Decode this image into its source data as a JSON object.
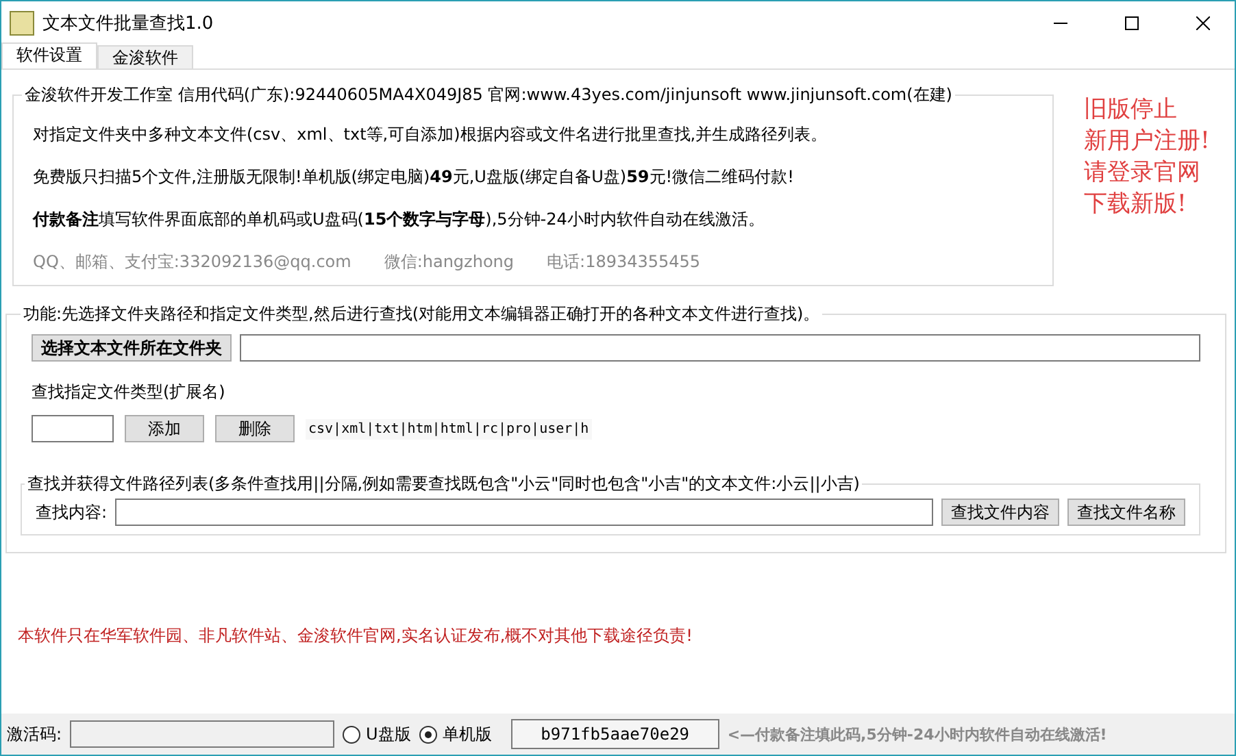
{
  "window": {
    "title": "文本文件批量查找1.0"
  },
  "tabs": [
    {
      "label": "软件设置",
      "selected": true
    },
    {
      "label": "金浚软件",
      "selected": false
    }
  ],
  "info": {
    "legend": "金浚软件开发工作室 信用代码(广东):92440605MA4X049J85 官网:www.43yes.com/jinjunsoft  www.jinjunsoft.com(在建)",
    "lines": [
      "对指定文件夹中多种文本文件(csv、xml、txt等,可自添加)根据内容或文件名进行批里查找,并生成路径列表。",
      "免费版只扫描5个文件,注册版无限制!单机版(绑定电脑)**49**元,U盘版(绑定自备U盘)**59**元!微信二维码付款!",
      "**付款备注**填写软件界面底部的单机码或U盘码(**15个数字与字母**),5分钟-24小时内软件自动在线激活。"
    ],
    "contacts": [
      "QQ、邮箱、支付宝:332092136@qq.com",
      "微信:hangzhong",
      "电话:18934355455"
    ]
  },
  "notice": [
    "旧版停止",
    "新用户注册!",
    "请登录官网",
    "下载新版!"
  ],
  "function": {
    "legend": "功能:先选择文件夹路径和指定文件类型,然后进行查找(对能用文本编辑器正确打开的各种文本文件进行查找)。",
    "folder_button": "选择文本文件所在文件夹",
    "type_label": "查找指定文件类型(扩展名)",
    "add_button": "添加",
    "delete_button": "删除",
    "extensions": "csv|xml|txt|htm|html|rc|pro|user|h",
    "search": {
      "legend": "查找并获得文件路径列表(多条件查找用||分隔,例如需要查找既包含\"小云\"同时也包含\"小吉\"的文本文件:小云||小吉)",
      "label": "查找内容:",
      "buttons": [
        "查找文件内容",
        "查找文件名称"
      ]
    }
  },
  "disclaimer": "本软件只在华军软件园、非凡软件站、金浚软件官网,实名认证发布,概不对其他下载途径负责!",
  "status_bar": {
    "label": "激活码:",
    "options": [
      {
        "label": "U盘版",
        "selected": false
      },
      {
        "label": "单机版",
        "selected": true
      }
    ],
    "machine_code": "b971fb5aae70e29",
    "hint": "<—付款备注填此码,5分钟-24小时内软件自动在线激活!"
  }
}
